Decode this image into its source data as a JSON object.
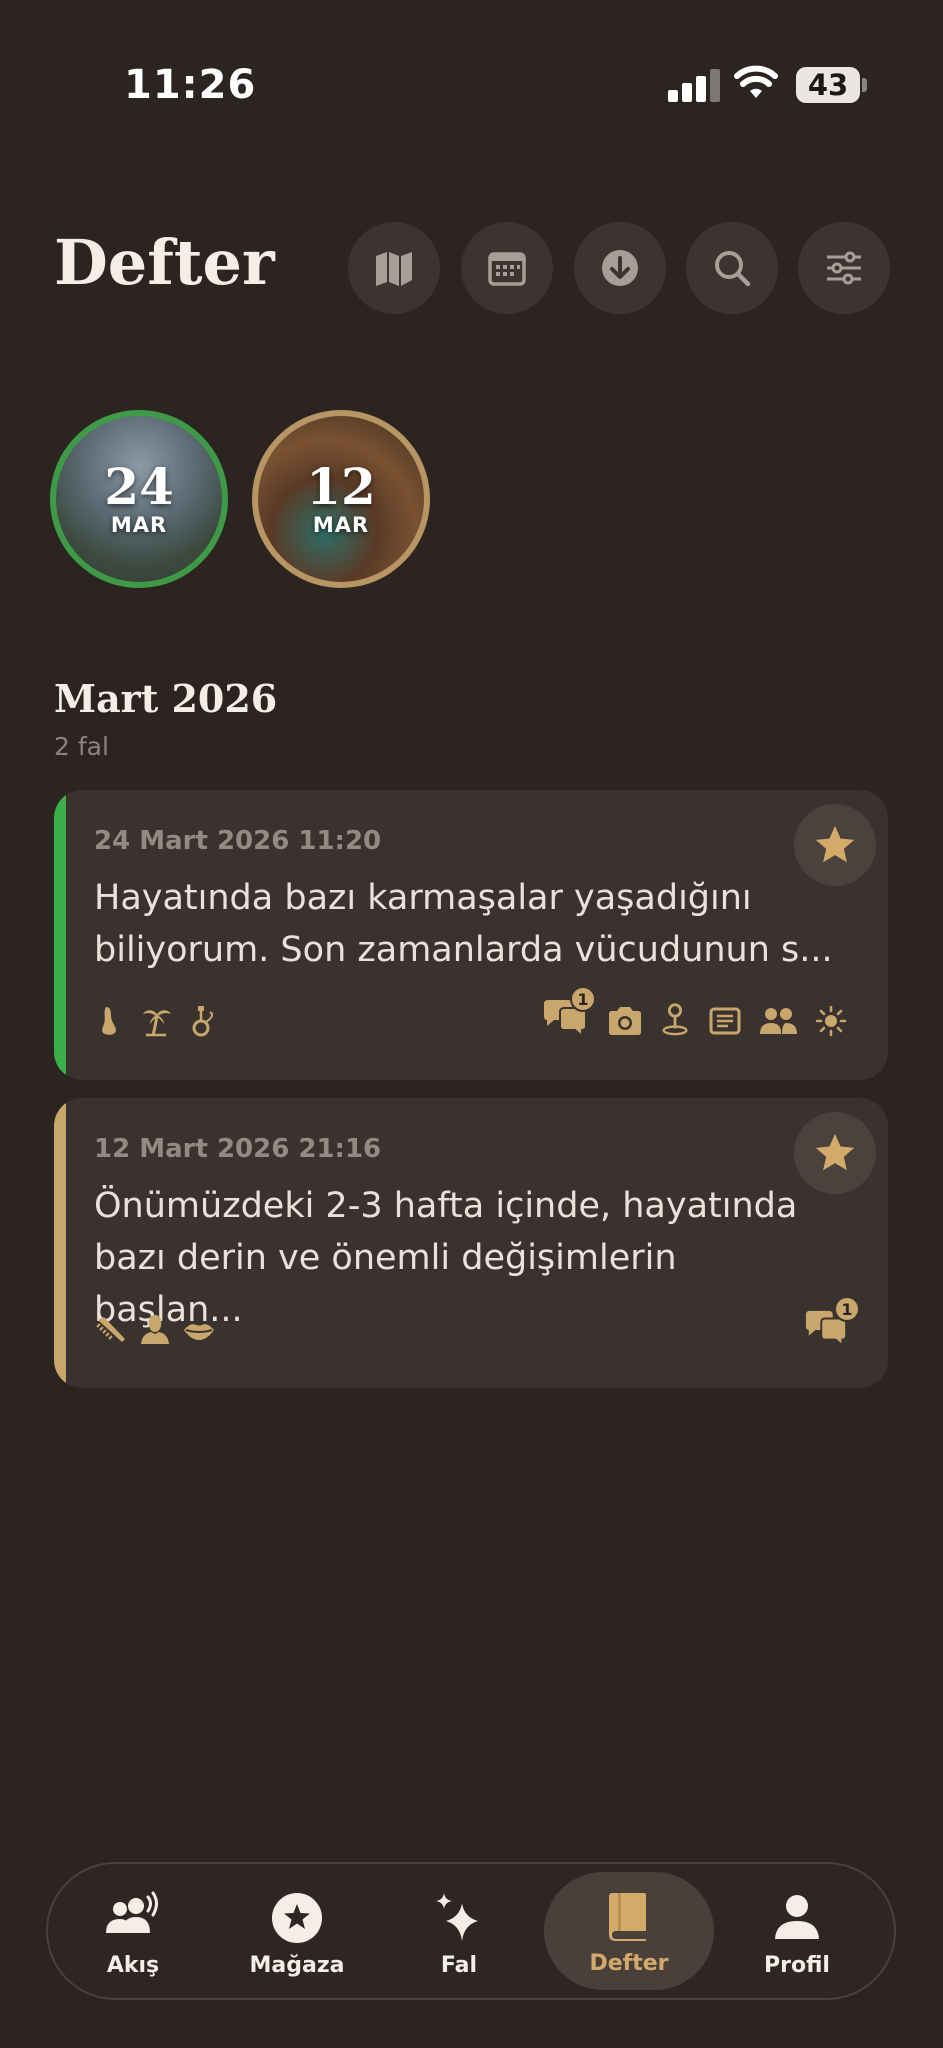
{
  "status_bar": {
    "time": "11:26",
    "battery": "43"
  },
  "header": {
    "title": "Defter",
    "buttons": [
      {
        "name": "map-button",
        "icon": "map-icon"
      },
      {
        "name": "calendar-button",
        "icon": "calendar-icon"
      },
      {
        "name": "download-button",
        "icon": "download-icon"
      },
      {
        "name": "search-button",
        "icon": "search-icon"
      },
      {
        "name": "filter-button",
        "icon": "sliders-icon"
      }
    ]
  },
  "stories": [
    {
      "day": "24",
      "month": "MAR",
      "ring_color": "#3f9a48"
    },
    {
      "day": "12",
      "month": "MAR",
      "ring_color": "#b89663"
    }
  ],
  "section": {
    "title": "Mart 2026",
    "count": "2 fal"
  },
  "cards": [
    {
      "date": "24 Mart 2026 11:20",
      "text": "Hayatında bazı karmaşalar yaşadığını biliyorum. Son zamanlarda vücudunun s...",
      "accent": "#3cae4a",
      "category_icons": [
        "foot-icon",
        "palm-tree-icon",
        "hookah-icon"
      ],
      "comment_count": "1",
      "meta_icons": [
        "camera-icon",
        "location-pin-icon",
        "note-icon",
        "people-icon",
        "sun-icon"
      ]
    },
    {
      "date": "12 Mart 2026 21:16",
      "text": "Önümüzdeki 2-3 hafta içinde, hayatında bazı derin ve önemli değişimlerin başlan...",
      "accent": "#c9a66b",
      "category_icons": [
        "comb-icon",
        "person-bust-icon",
        "lips-icon"
      ],
      "comment_count": "1",
      "meta_icons": []
    }
  ],
  "nav": {
    "items": [
      {
        "label": "Akış",
        "icon": "people-broadcast-icon"
      },
      {
        "label": "Mağaza",
        "icon": "star-badge-icon"
      },
      {
        "label": "Fal",
        "icon": "sparkles-icon"
      },
      {
        "label": "Defter",
        "icon": "book-icon",
        "active": true
      },
      {
        "label": "Profil",
        "icon": "person-icon"
      }
    ]
  },
  "colors": {
    "background": "#2b2421",
    "card": "#3a322f",
    "gold": "#c9a66b",
    "green": "#3cae4a"
  }
}
